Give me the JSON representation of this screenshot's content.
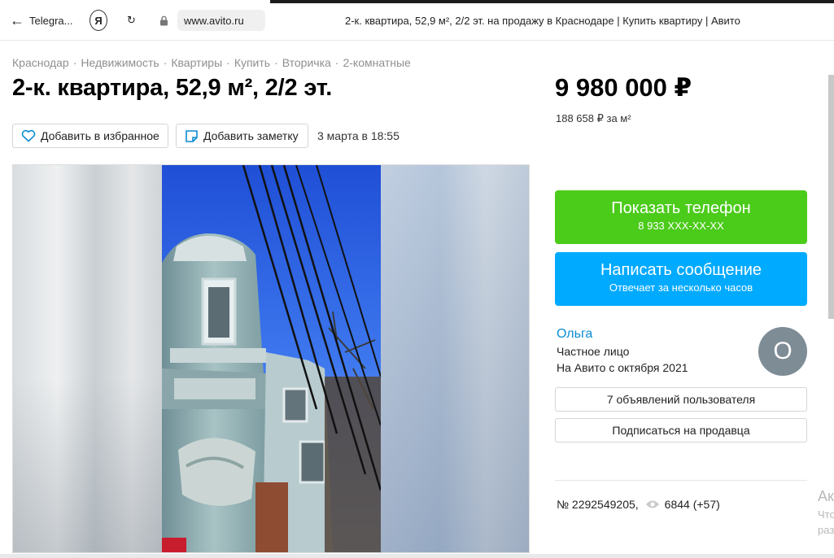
{
  "browser": {
    "back_label": "Telegra...",
    "yandex_label": "Я",
    "url": "www.avito.ru",
    "tab_title": "2-к. квартира, 52,9 м², 2/2 эт. на продажу в Краснодаре | Купить квартиру | Авито"
  },
  "breadcrumbs": [
    "Краснодар",
    "Недвижимость",
    "Квартиры",
    "Купить",
    "Вторичка",
    "2-комнатные"
  ],
  "listing": {
    "title": "2-к. квартира, 52,9 м², 2/2 эт.",
    "favorite_label": "Добавить в избранное",
    "note_label": "Добавить заметку",
    "date": "3 марта в 18:55",
    "price": "9 980 000 ₽",
    "price_per_m": "188 658 ₽ за м²",
    "number": "№ 2292549205,",
    "views": "6844 (+57)"
  },
  "actions": {
    "phone_label": "Показать телефон",
    "phone_sub": "8 933 XXX-XX-XX",
    "message_label": "Написать сообщение",
    "message_sub": "Отвечает за несколько часов",
    "ads_label": "7 объявлений пользователя",
    "subscribe_label": "Подписаться на продавца"
  },
  "seller": {
    "name": "Ольга",
    "type": "Частное лицо",
    "since": "На Авито с октября 2021",
    "avatar_letter": "О"
  },
  "overlay": {
    "line1": "Ак",
    "line2": "Что",
    "line3": "раз"
  },
  "colors": {
    "green": "#4bcb1a",
    "blue": "#00aaff",
    "link": "#0a8cd2"
  }
}
